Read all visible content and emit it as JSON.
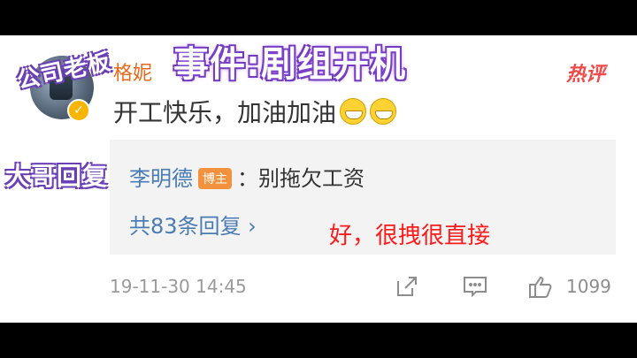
{
  "comment": {
    "username": "格妮",
    "hot_label": "热评",
    "text": "开工快乐，加油加油",
    "emoji_icons": [
      "grin-icon",
      "grin-icon"
    ]
  },
  "reply": {
    "name": "李明德",
    "badge": "博主",
    "text": "：别拖欠工资",
    "more": "共83条回复 ›"
  },
  "footer": {
    "timestamp": "19-11-30 14:45",
    "likes": "1099"
  },
  "overlays": {
    "title": "事件:剧组开机",
    "boss": "公司老板",
    "big_brother": "大哥回复",
    "caption": "好，很拽很直接"
  }
}
